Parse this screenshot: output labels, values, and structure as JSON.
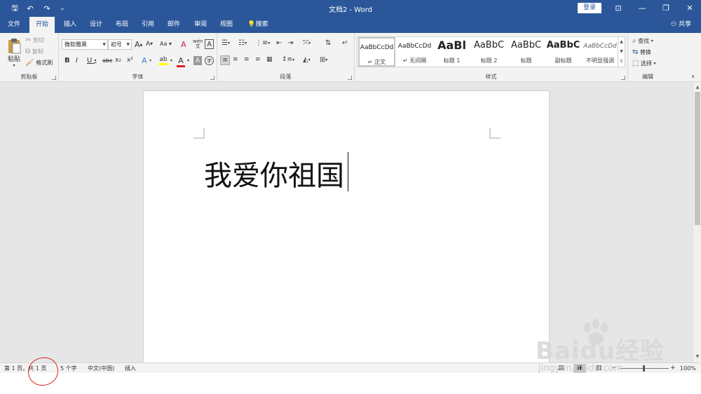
{
  "title_bar": {
    "doc_title": "文档2 - Word",
    "login_label": "登录",
    "quick_access": {
      "save": "🖫",
      "undo": "↶",
      "redo": "↷",
      "customize": "⌄"
    },
    "window_buttons": {
      "ribbon_options": "⊡",
      "minimize": "—",
      "restore": "❐",
      "close": "✕"
    }
  },
  "tabs": [
    {
      "label": "文件"
    },
    {
      "label": "开始"
    },
    {
      "label": "插入"
    },
    {
      "label": "设计"
    },
    {
      "label": "布局"
    },
    {
      "label": "引用"
    },
    {
      "label": "邮件"
    },
    {
      "label": "审阅"
    },
    {
      "label": "视图"
    }
  ],
  "search_label": "搜索",
  "share_label": "共享",
  "ribbon": {
    "clipboard": {
      "label": "剪贴板",
      "paste": "粘贴",
      "cut": "剪切",
      "copy": "复制",
      "format_painter": "格式刷"
    },
    "font": {
      "label": "字体",
      "font_name": "微软雅黑",
      "font_size": "初号",
      "grow": "A",
      "shrink": "A",
      "change_case": "Aa",
      "clear_format": "A",
      "phonetic": "wén",
      "char_border": "A",
      "bold": "B",
      "italic": "I",
      "underline": "U",
      "strike": "abc",
      "subscript": "x₂",
      "superscript": "x²",
      "text_effects": "A",
      "highlight": "ab",
      "font_color": "A",
      "char_shading": "A",
      "enclose": "字"
    },
    "paragraph": {
      "label": "段落"
    },
    "styles": {
      "label": "样式",
      "items": [
        {
          "sample": "AaBbCcDd",
          "name": "↵ 正文"
        },
        {
          "sample": "AaBbCcDd",
          "name": "↵ 无间隔"
        },
        {
          "sample": "AaBl",
          "name": "标题 1"
        },
        {
          "sample": "AaBbC",
          "name": "标题 2"
        },
        {
          "sample": "AaBbC",
          "name": "标题"
        },
        {
          "sample": "AaBbC",
          "name": "副标题"
        },
        {
          "sample": "AaBbCcDd",
          "name": "不明显强调"
        }
      ]
    },
    "editing": {
      "label": "编辑",
      "find": "查找",
      "replace": "替换",
      "select": "选择"
    }
  },
  "document": {
    "text": "我爱你祖国"
  },
  "status_bar": {
    "page": "第 1 页，共 1 页",
    "words": "5 个字",
    "language": "中文(中国)",
    "mode": "插入",
    "zoom": "100%"
  },
  "watermark": {
    "text": "Baidu经验",
    "sub": "jingyan.baidu.com"
  },
  "colors": {
    "accent": "#2b579a",
    "ribbon_bg": "#f3f3f3",
    "doc_bg": "#e6e6e6",
    "annotation": "#e02020"
  }
}
